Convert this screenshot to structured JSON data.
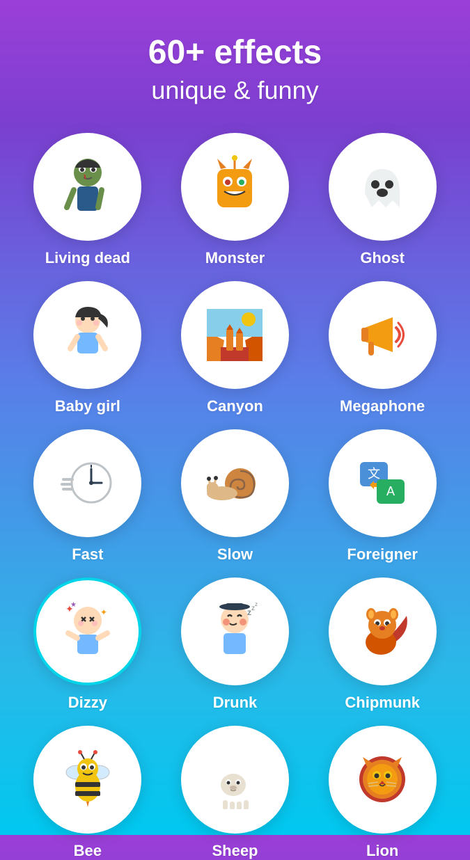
{
  "header": {
    "title": "60+ effects",
    "subtitle": "unique & funny"
  },
  "effects": [
    {
      "id": "living-dead",
      "label": "Living dead",
      "emoji": "🧟",
      "hasTealBorder": false
    },
    {
      "id": "monster",
      "label": "Monster",
      "emoji": "👾",
      "hasTealBorder": false
    },
    {
      "id": "ghost",
      "label": "Ghost",
      "emoji": "👻",
      "hasTealBorder": false
    },
    {
      "id": "baby-girl",
      "label": "Baby girl",
      "emoji": "👧",
      "hasTealBorder": false
    },
    {
      "id": "canyon",
      "label": "Canyon",
      "emoji": "🏜️",
      "hasTealBorder": false
    },
    {
      "id": "megaphone",
      "label": "Megaphone",
      "emoji": "📣",
      "hasTealBorder": false
    },
    {
      "id": "fast",
      "label": "Fast",
      "emoji": "⏱️",
      "hasTealBorder": false
    },
    {
      "id": "slow",
      "label": "Slow",
      "emoji": "🐌",
      "hasTealBorder": false
    },
    {
      "id": "foreigner",
      "label": "Foreigner",
      "emoji": "🈲",
      "hasTealBorder": false
    },
    {
      "id": "dizzy",
      "label": "Dizzy",
      "emoji": "😵",
      "hasTealBorder": true
    },
    {
      "id": "drunk",
      "label": "Drunk",
      "emoji": "🤦",
      "hasTealBorder": false
    },
    {
      "id": "chipmunk",
      "label": "Chipmunk",
      "emoji": "🐿️",
      "hasTealBorder": false
    },
    {
      "id": "bee",
      "label": "Bee",
      "emoji": "🐝",
      "hasTealBorder": false
    },
    {
      "id": "sheep",
      "label": "Sheep",
      "emoji": "🐑",
      "hasTealBorder": false
    },
    {
      "id": "lion",
      "label": "Lion",
      "emoji": "🦁",
      "hasTealBorder": false
    }
  ],
  "colors": {
    "background_start": "#9b3fd8",
    "background_end": "#00c8f0",
    "teal_border": "#00d4e8",
    "white": "#ffffff",
    "text": "#ffffff"
  }
}
